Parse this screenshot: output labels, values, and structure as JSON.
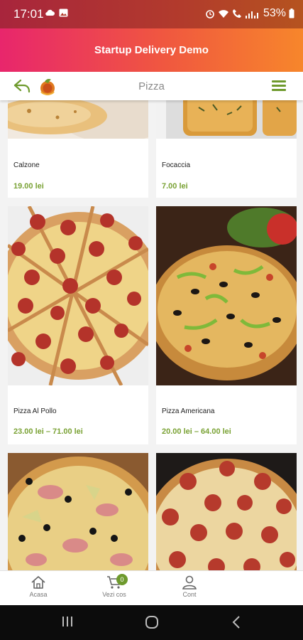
{
  "status_bar": {
    "time": "17:01",
    "battery": "53%",
    "icons_left": [
      "cloud-icon",
      "image-icon"
    ],
    "icons_right": [
      "alarm-icon",
      "wifi-icon",
      "call-icon",
      "signal-icon",
      "battery-icon"
    ]
  },
  "app": {
    "title": "Startup Delivery Demo",
    "accent_color": "#6e9a2d",
    "header_gradient": [
      "#e8266c",
      "#f7862b"
    ]
  },
  "navbar": {
    "title": "Pizza"
  },
  "products": [
    {
      "name": "Calzone",
      "price": "19.00 lei",
      "image": "calzone-photo"
    },
    {
      "name": "Focaccia",
      "price": "7.00 lei",
      "image": "focaccia-photo"
    },
    {
      "name": "Pizza Al Pollo",
      "price": "23.00 lei – 71.00 lei",
      "image": "pepperoni-pizza-photo"
    },
    {
      "name": "Pizza Americana",
      "price": "20.00 lei – 64.00 lei",
      "image": "americana-pizza-photo"
    },
    {
      "name": "",
      "price": "",
      "image": "capricciosa-pizza-photo"
    },
    {
      "name": "",
      "price": "",
      "image": "salami-pizza-photo"
    }
  ],
  "bottom_nav": {
    "home": "Acasa",
    "cart": "Vezi cos",
    "cart_count": "0",
    "account": "Cont"
  }
}
